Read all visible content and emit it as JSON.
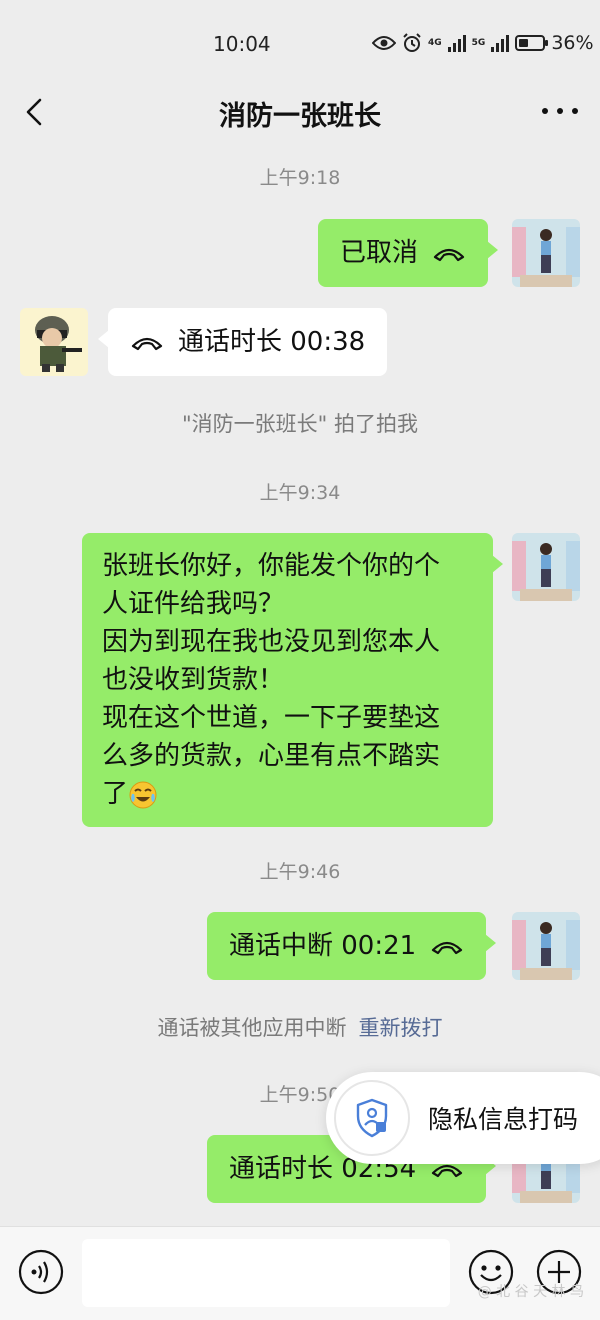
{
  "status_bar": {
    "time": "10:04",
    "net1": "4G",
    "net2": "5G",
    "battery": "36%"
  },
  "header": {
    "title": "消防一张班长"
  },
  "messages": {
    "t1": "上午9:18",
    "m1": "已取消",
    "m2": "通话时长 00:38",
    "pat": "\"消防一张班长\" 拍了拍我",
    "t2": "上午9:34",
    "m3_lines": [
      "张班长你好，你能发个你的个",
      "人证件给我吗？",
      "因为到现在我也没见到您本人",
      "也没收到货款！",
      "现在这个世道，一下子要垫这",
      "么多的货款，心里有点不踏实",
      "了"
    ],
    "t3": "上午9:46",
    "m4": "通话中断 00:21",
    "sys_interrupt": "通话被其他应用中断",
    "redial": "重新拨打",
    "t4": "上午9:50",
    "m5": "通话时长 02:54"
  },
  "overlay": {
    "privacy_label": "隐私信息打码"
  },
  "input_bar": {
    "watermark": "@ 北 谷 天 林 鸟"
  },
  "colors": {
    "my_bubble": "#95ec69",
    "their_bubble": "#ffffff",
    "background": "#ededed",
    "link": "#576b95"
  }
}
